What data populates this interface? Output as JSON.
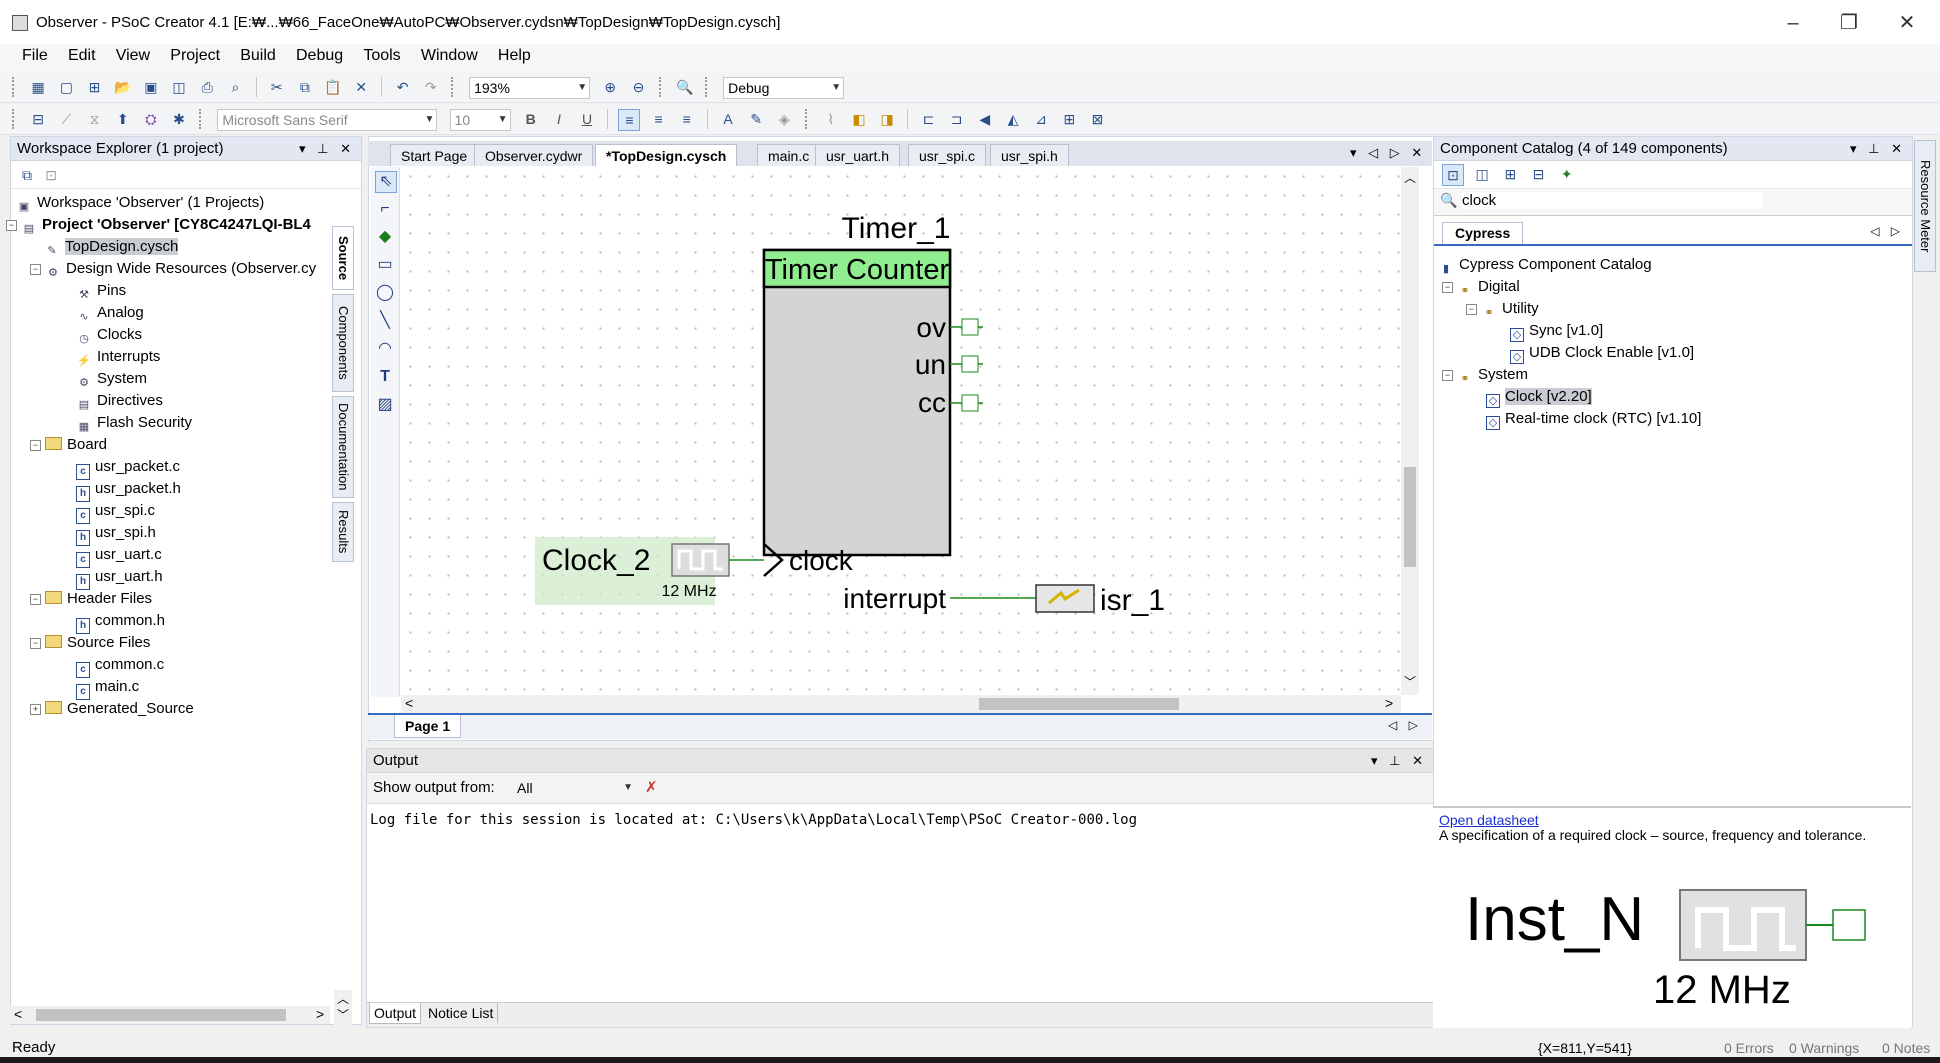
{
  "window": {
    "title": "Observer - PSoC Creator 4.1  [E:₩...₩66_FaceOne₩AutoPC₩Observer.cydsn₩TopDesign₩TopDesign.cysch]",
    "minimize": "–",
    "restore": "❐",
    "close": "✕"
  },
  "menu": [
    "File",
    "Edit",
    "View",
    "Project",
    "Build",
    "Debug",
    "Tools",
    "Window",
    "Help"
  ],
  "toolbar": {
    "zoom": "193%",
    "config": "Debug",
    "font_family": "Microsoft Sans Serif",
    "font_size": "10"
  },
  "workspace": {
    "header": "Workspace Explorer (1 project)",
    "items": [
      {
        "label": "Workspace 'Observer' (1 Projects)",
        "icon": "workspace-icon"
      },
      {
        "label": "Project  'Observer' [CY8C4247LQI-BL4",
        "icon": "project-icon"
      },
      {
        "label": "TopDesign.cysch",
        "icon": "schematic-icon"
      },
      {
        "label": "Design Wide Resources (Observer.cy",
        "icon": "resources-icon"
      },
      {
        "label": "Pins",
        "icon": "pins-icon"
      },
      {
        "label": "Analog",
        "icon": "analog-icon"
      },
      {
        "label": "Clocks",
        "icon": "clock-icon"
      },
      {
        "label": "Interrupts",
        "icon": "interrupt-icon"
      },
      {
        "label": "System",
        "icon": "system-icon"
      },
      {
        "label": "Directives",
        "icon": "directives-icon"
      },
      {
        "label": "Flash Security",
        "icon": "lock-icon"
      },
      {
        "label": "Board",
        "icon": "folder-icon"
      },
      {
        "label": "usr_packet.c",
        "icon": "c-file-icon"
      },
      {
        "label": "usr_packet.h",
        "icon": "h-file-icon"
      },
      {
        "label": "usr_spi.c",
        "icon": "c-file-icon"
      },
      {
        "label": "usr_spi.h",
        "icon": "h-file-icon"
      },
      {
        "label": "usr_uart.c",
        "icon": "c-file-icon"
      },
      {
        "label": "usr_uart.h",
        "icon": "h-file-icon"
      },
      {
        "label": "Header Files",
        "icon": "folder-icon"
      },
      {
        "label": "common.h",
        "icon": "h-file-icon"
      },
      {
        "label": "Source Files",
        "icon": "folder-icon"
      },
      {
        "label": "common.c",
        "icon": "c-file-icon"
      },
      {
        "label": "main.c",
        "icon": "c-file-icon"
      },
      {
        "label": "Generated_Source",
        "icon": "folder-icon"
      }
    ],
    "side_tabs": [
      "Source",
      "Components",
      "Documentation",
      "Results"
    ]
  },
  "editor": {
    "tabs": [
      "Start Page",
      "Observer.cydwr",
      "*TopDesign.cysch",
      "main.c",
      "usr_uart.h",
      "usr_spi.c",
      "usr_spi.h"
    ],
    "page_tab": "Page 1",
    "schematic": {
      "instance_name": "Timer_1",
      "component_title": "Timer Counter",
      "pins": [
        "ov",
        "un",
        "cc"
      ],
      "clock_pin": "clock",
      "interrupt_pin": "interrupt",
      "clock_name": "Clock_2",
      "clock_freq": "12 MHz",
      "isr_name": "isr_1"
    }
  },
  "output": {
    "header": "Output",
    "show_from_label": "Show output from:",
    "show_from_value": "All",
    "log_line": "Log file for this session is located at: C:\\Users\\k\\AppData\\Local\\Temp\\PSoC Creator-000.log",
    "tabs": [
      "Output",
      "Notice List"
    ]
  },
  "catalog": {
    "header": "Component Catalog (4 of 149 components)",
    "search": "clock",
    "tab": "Cypress",
    "tree": [
      {
        "label": "Cypress Component Catalog"
      },
      {
        "label": "Digital"
      },
      {
        "label": "Utility"
      },
      {
        "label": "Sync [v1.0]"
      },
      {
        "label": "UDB Clock Enable [v1.0]"
      },
      {
        "label": "System"
      },
      {
        "label": "Clock [v2.20]"
      },
      {
        "label": "Real-time clock (RTC) [v1.10]"
      }
    ],
    "datasheet_link": "Open datasheet",
    "description": "A specification of a required clock – source, frequency and tolerance.",
    "preview_name": "Inst_N",
    "preview_freq": "12 MHz",
    "side_tab": "Resource Meter"
  },
  "status": {
    "ready": "Ready",
    "coords": "{X=811,Y=541}",
    "errors": "0 Errors",
    "warnings": "0 Warnings",
    "notes": "0 Notes"
  }
}
